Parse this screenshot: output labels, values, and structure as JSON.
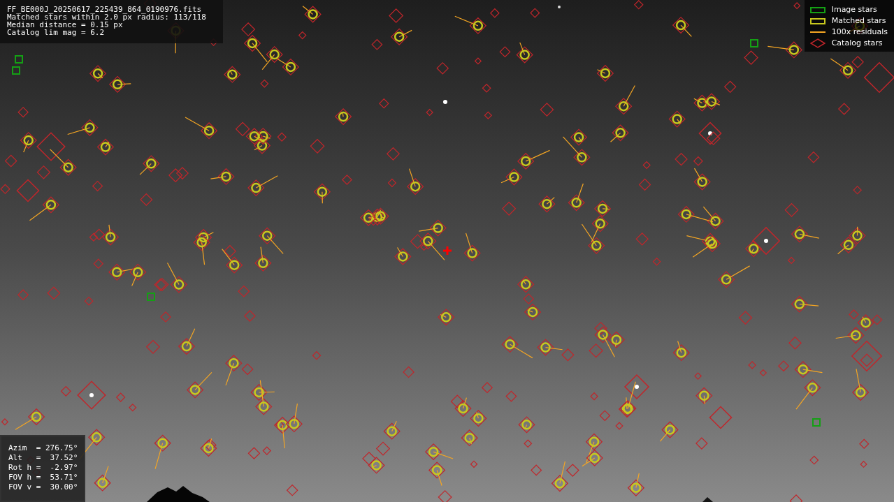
{
  "info": {
    "lines": [
      "FF_BE000J_20250617_225439_864_0190976.fits",
      "Matched stars within 2.0 px radius: 113/118",
      "Median distance = 0.15 px",
      "Catalog lim mag = 6.2"
    ]
  },
  "legend": [
    {
      "kind": "image_stars",
      "label": "Image stars"
    },
    {
      "kind": "matched_stars",
      "label": "Matched stars"
    },
    {
      "kind": "residuals",
      "label": "100x residuals"
    },
    {
      "kind": "catalog_stars",
      "label": "Catalog stars"
    }
  ],
  "pointing": {
    "lines": [
      "Azim  = 276.75°",
      "Alt   =  37.52°",
      "Rot h =  -2.97°",
      "FOV h =  53.71°",
      "FOV v =  30.00°"
    ]
  }
}
